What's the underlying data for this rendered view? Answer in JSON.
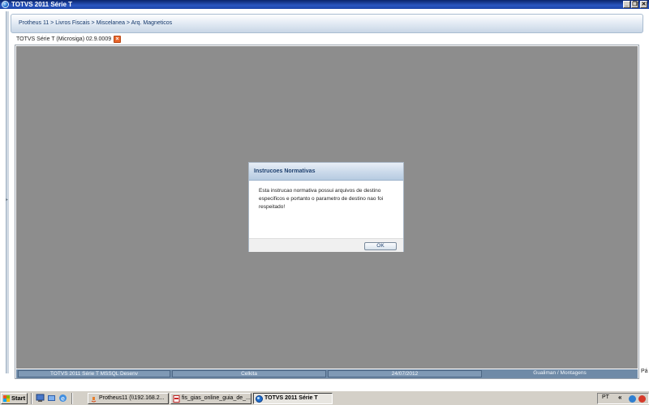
{
  "window": {
    "title": "TOTVS 2011 Série T",
    "minimize_glyph": "_",
    "restore_glyph": "❐",
    "close_glyph": "✕"
  },
  "header": {
    "breadcrumb": "Protheus 11 > Livros Fiscais > Miscelanea > Arq. Magneticos"
  },
  "tab": {
    "label": "TOTVS Série T  (Microsiga) 02.9.0009",
    "close_glyph": "×"
  },
  "dialog": {
    "title": "Instrucoes Normativas",
    "message": "Esta instrucao normativa possui arquivos de destino especificos e portanto o parametro de destino nao foi respeitado!",
    "ok_label": "OK"
  },
  "statusbar": {
    "segments": [
      "TOTVS 2011 Série T  MSSQL Desenv",
      "Celkita",
      "24/07/2012",
      "Gualiman / Montagens"
    ]
  },
  "page_edge_text": "Pá",
  "taskbar": {
    "start_label": "Start",
    "tasks": [
      "Protheus11 (\\\\192.168.2...",
      "fis_gias_online_guia_de_...",
      "TOTVS 2011 Série T"
    ],
    "tray_lang": "PT",
    "tray_arrows": "«"
  },
  "colors": {
    "titlebar": "#0a246a",
    "workspace": "#8d8d8d",
    "statusbar": "#6f8aa7",
    "tab_close": "#e8642a"
  },
  "icons": [
    "app-globe-icon",
    "minimize-icon",
    "restore-icon",
    "close-icon",
    "tab-close-icon",
    "windows-logo-icon",
    "show-desktop-icon",
    "ie-icon",
    "media-icon",
    "java-icon",
    "pdf-icon",
    "totvs-icon",
    "network-icon",
    "acrobat-tray-icon"
  ]
}
